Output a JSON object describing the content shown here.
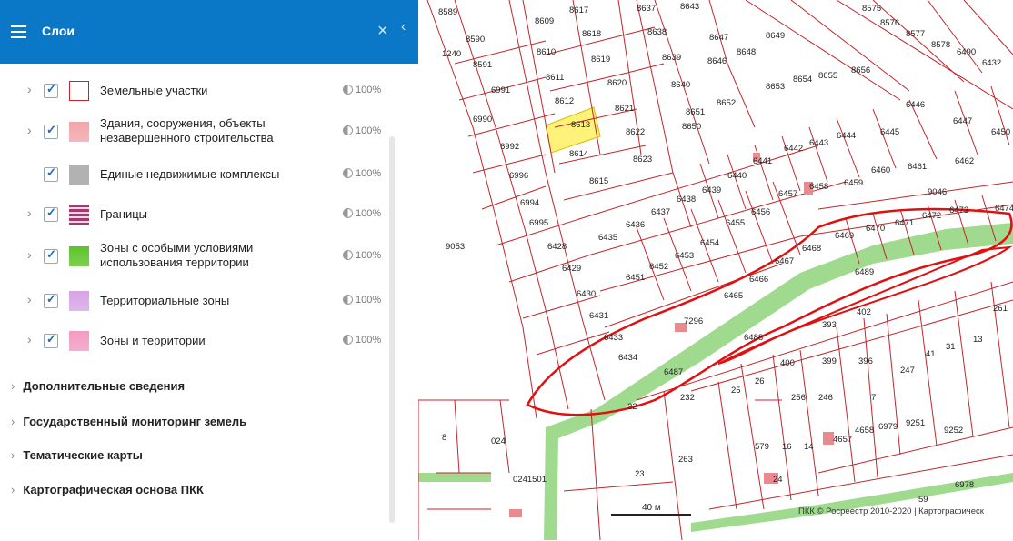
{
  "panel": {
    "title": "Слои",
    "layers": [
      {
        "label": "Земельные участки",
        "opacity": "100%",
        "swatch": "#ffffff",
        "swatch_border": "#c0262c",
        "expandable": true,
        "checked": true
      },
      {
        "label": "Здания, сооружения, объекты незавершенного строительства",
        "opacity": "100%",
        "swatch": "#f2a5aa",
        "expandable": true,
        "checked": true
      },
      {
        "label": "Единые недвижимые комплексы",
        "opacity": "100%",
        "swatch": "#b2b2b2",
        "expandable": false,
        "checked": true
      },
      {
        "label": "Границы",
        "opacity": "100%",
        "swatch": "stripes",
        "expandable": true,
        "checked": true
      },
      {
        "label": "Зоны с особыми условиями использования территории",
        "opacity": "100%",
        "swatch": "#5ec32a",
        "expandable": true,
        "checked": true
      },
      {
        "label": "Территориальные зоны",
        "opacity": "100%",
        "swatch": "#d8a3e6",
        "expandable": true,
        "checked": true
      },
      {
        "label": "Зоны и территории",
        "opacity": "100%",
        "swatch": "#f39ac4",
        "expandable": true,
        "checked": true
      }
    ],
    "sections": [
      {
        "label": "Дополнительные сведения"
      },
      {
        "label": "Государственный мониторинг земель"
      },
      {
        "label": "Тематические карты"
      },
      {
        "label": "Картографическая основа ПКК"
      }
    ],
    "icons": {
      "menu": "hamburger-icon",
      "close": "close-icon",
      "collapse": "chevron-left-icon"
    },
    "accent": "#0a78c7"
  },
  "map": {
    "scale_label": "40 м",
    "copyright": "ПКК © Росреестр 2010-2020 | Картографическ",
    "highlight_color": "#fff27a",
    "parcel_line_color": "#c0262c",
    "zone_color": "#8fd47b",
    "parcel_labels": [
      "8589",
      "8609",
      "8617",
      "8637",
      "8643",
      "8575",
      "8576",
      "8577",
      "8578",
      "6490",
      "6432",
      "8590",
      "8610",
      "8618",
      "8638",
      "8647",
      "8648",
      "8649",
      "8591",
      "8611",
      "8619",
      "8639",
      "8646",
      "8653",
      "8654",
      "8655",
      "8656",
      "1240",
      "6991",
      "8612",
      "8620",
      "8640",
      "8651",
      "8652",
      "8613",
      "8621",
      "6446",
      "6447",
      "6450",
      "6990",
      "8650",
      "6445",
      "6992",
      "8614",
      "8622",
      "6441",
      "6442",
      "6443",
      "6444",
      "6460",
      "6461",
      "6462",
      "8623",
      "6996",
      "8615",
      "6440",
      "6459",
      "6458",
      "6457",
      "6439",
      "6438",
      "6437",
      "6436",
      "6435",
      "6994",
      "6995",
      "6455",
      "6456",
      "6454",
      "6453",
      "6452",
      "6451",
      "9053",
      "6428",
      "6429",
      "6430",
      "6431",
      "6433",
      "6434",
      "6468",
      "6467",
      "6466",
      "6465",
      "9046",
      "6469",
      "6470",
      "6471",
      "6472",
      "6473",
      "6474",
      "6489",
      "7296",
      "6488",
      "6487",
      "402",
      "393",
      "396",
      "399",
      "400",
      "261",
      "13",
      "31",
      "41",
      "247",
      "7",
      "26",
      "25",
      "256",
      "246",
      "232",
      "22",
      "23",
      "263",
      "24",
      "579",
      "16",
      "14",
      "4657",
      "4658",
      "6979",
      "9251",
      "9252",
      "6978",
      "59",
      "8",
      "024",
      "0241501"
    ]
  }
}
